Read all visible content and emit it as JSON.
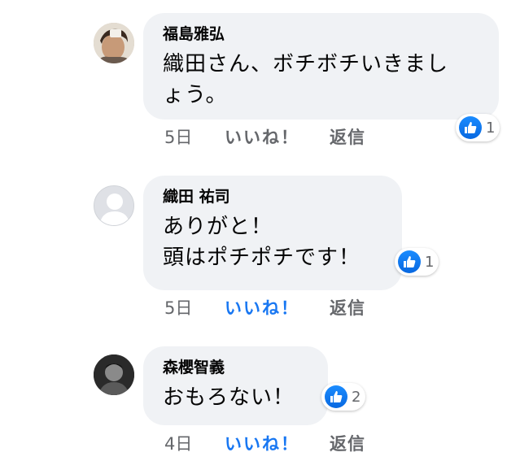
{
  "comments": [
    {
      "author": "福島雅弘",
      "text": "織田さん、ボチボチいきまし\nょう。",
      "reaction_count": "1",
      "time": "5日",
      "like_label": "いいね！",
      "reply_label": "返信",
      "liked": false,
      "avatar": "photo-avatar"
    },
    {
      "author": "織田 祐司",
      "text": "ありがと！\n頭はポチポチです！",
      "reaction_count": "1",
      "time": "5日",
      "like_label": "いいね！",
      "reply_label": "返信",
      "liked": true,
      "avatar": "default-avatar"
    },
    {
      "author": "森櫻智義",
      "text": "おもろない！",
      "reaction_count": "2",
      "time": "4日",
      "like_label": "いいね！",
      "reply_label": "返信",
      "liked": true,
      "avatar": "photo-avatar"
    }
  ],
  "colors": {
    "bubble": "#f0f2f5",
    "like_active": "#1877f2",
    "meta_text": "#65676b"
  }
}
